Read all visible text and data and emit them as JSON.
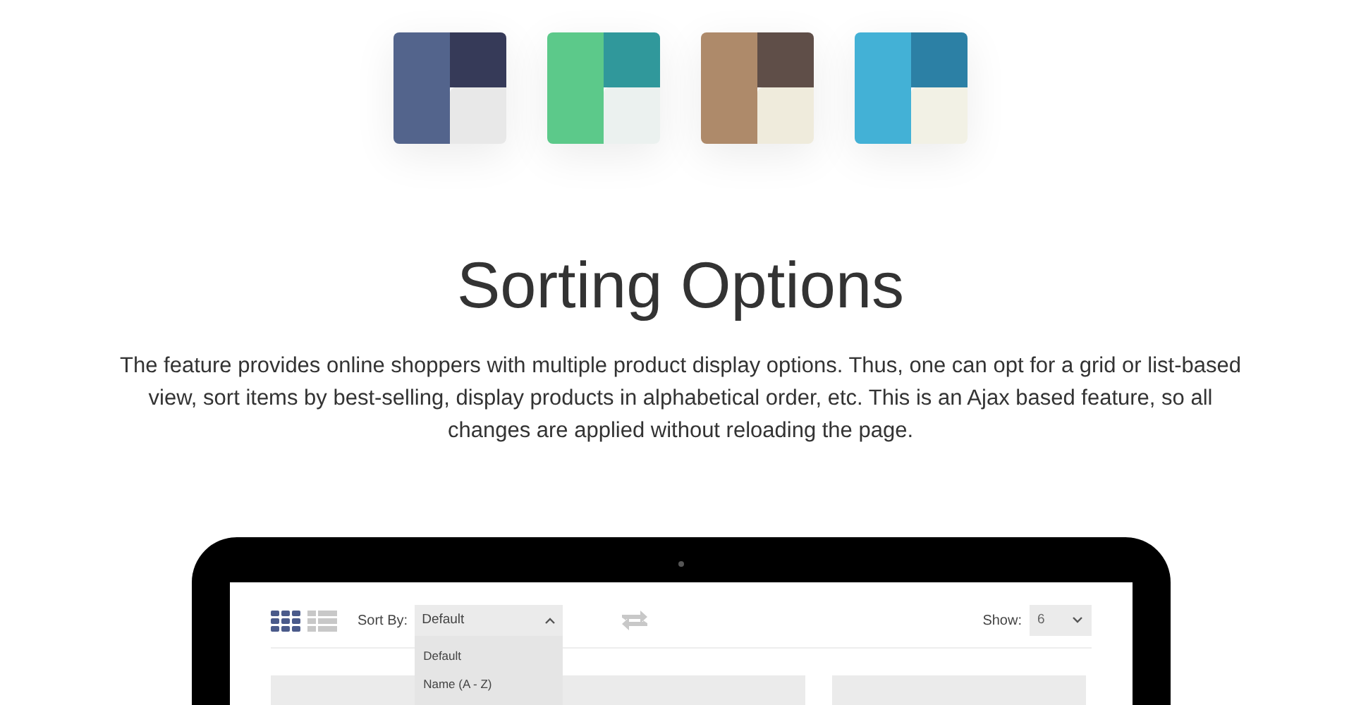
{
  "palettes": [
    {
      "parts": [
        {
          "color": "#53648c"
        },
        {
          "color": "#363a58"
        },
        {
          "color": "#e8e8e8"
        }
      ]
    },
    {
      "parts": [
        {
          "color": "#5cc98a"
        },
        {
          "color": "#30989b"
        },
        {
          "color": "#ebf1ef"
        }
      ]
    },
    {
      "parts": [
        {
          "color": "#ae8a6a"
        },
        {
          "color": "#5f4e48"
        },
        {
          "color": "#efebdc"
        }
      ]
    },
    {
      "parts": [
        {
          "color": "#43b1d6"
        },
        {
          "color": "#2c80a5"
        },
        {
          "color": "#f2f1e5"
        }
      ]
    }
  ],
  "title": "Sorting Options",
  "description": "The feature provides online shoppers with multiple product display options. Thus, one can opt for a grid or list-based view, sort items by best-selling, display products in alphabetical order, etc. This is an Ajax based feature, so all changes are applied without reloading the page.",
  "toolbar": {
    "views": [
      {
        "kind": "grid",
        "selected": true
      },
      {
        "kind": "list",
        "selected": false
      }
    ],
    "sort": {
      "label": "Sort By:",
      "value": "Default",
      "expanded": true,
      "options": [
        "Default",
        "Name (A - Z)"
      ]
    },
    "show": {
      "label": "Show:",
      "value": "6"
    }
  }
}
